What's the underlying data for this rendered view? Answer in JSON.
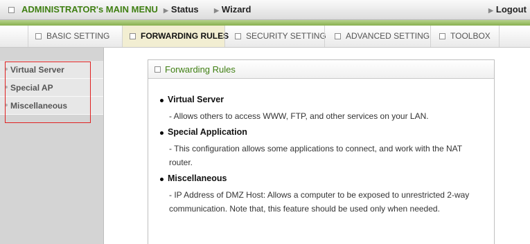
{
  "header": {
    "title": "ADMINISTRATOR's MAIN MENU",
    "nav": [
      {
        "label": "Status"
      },
      {
        "label": "Wizard"
      },
      {
        "label": "Logout"
      }
    ]
  },
  "tabs": [
    {
      "label": "BASIC SETTING",
      "active": false
    },
    {
      "label": "FORWARDING RULES",
      "active": true
    },
    {
      "label": "SECURITY SETTING",
      "active": false
    },
    {
      "label": "ADVANCED SETTING",
      "active": false
    },
    {
      "label": "TOOLBOX",
      "active": false
    }
  ],
  "sidebar": {
    "items": [
      {
        "label": "Virtual Server"
      },
      {
        "label": "Special AP"
      },
      {
        "label": "Miscellaneous"
      }
    ]
  },
  "panel": {
    "title": "Forwarding Rules",
    "sections": [
      {
        "title": "Virtual Server",
        "description": "- Allows others to access WWW, FTP, and other services on your LAN."
      },
      {
        "title": "Special Application",
        "description": "- This configuration allows some applications to connect, and work with the NAT router."
      },
      {
        "title": "Miscellaneous",
        "description": "- IP Address of DMZ Host: Allows a computer to be exposed to unrestricted 2-way communication. Note that, this feature should be used only when needed."
      }
    ]
  },
  "colors": {
    "accent_green": "#3f7f12",
    "green_strip": "#88b04f",
    "active_tab": "#f2eed2",
    "highlight_box": "#e02020"
  }
}
